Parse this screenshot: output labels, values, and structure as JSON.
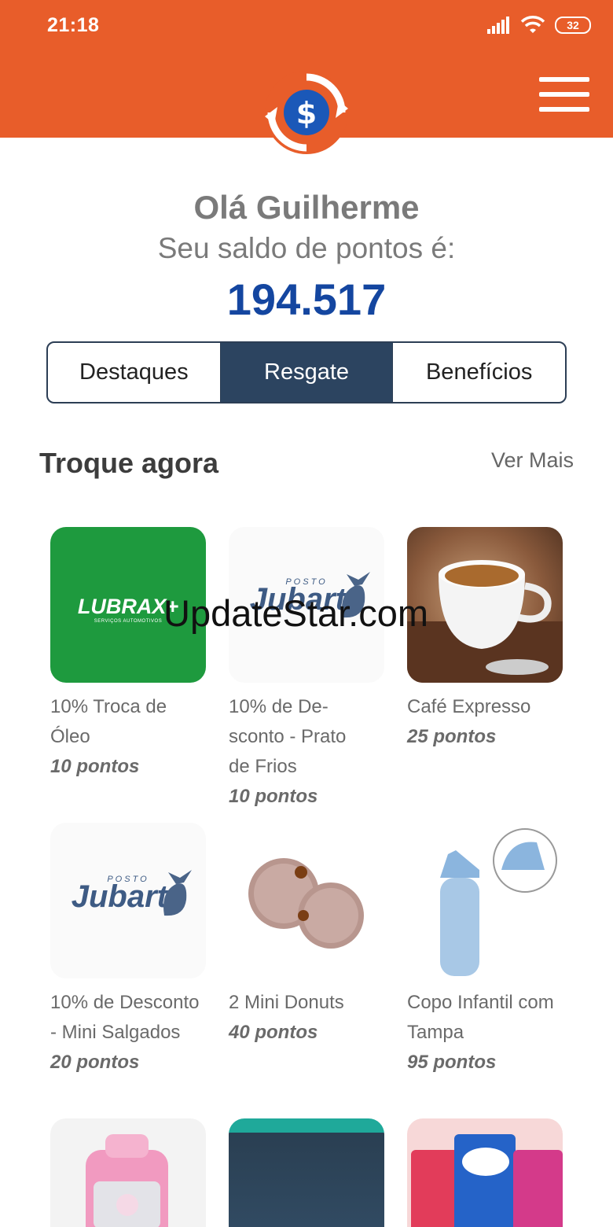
{
  "status": {
    "time": "21:18",
    "battery": "32"
  },
  "greeting": "Olá Guilherme",
  "subtitle": "Seu saldo de pontos é:",
  "points": "194.517",
  "tabs": [
    {
      "label": "Destaques",
      "active": false
    },
    {
      "label": "Resgate",
      "active": true
    },
    {
      "label": "Benefícios",
      "active": false
    }
  ],
  "section": {
    "title": "Troque agora",
    "see_more": "Ver Mais"
  },
  "items": [
    {
      "name": "10% Troca de Óleo",
      "points": "10 pontos",
      "brand": "LUBRAX+",
      "brand_sub": "SERVIÇOS AUTOMOTIVOS"
    },
    {
      "name": "10% de De-sconto - Prato de Frios",
      "points": "10 pontos",
      "brand": "Jubarte",
      "brand_sub": "POSTO"
    },
    {
      "name": "Café Expresso",
      "points": "25 pontos"
    },
    {
      "name": "10% de Desconto - Mini Salgados",
      "points": "20 pontos",
      "brand": "Jubarte",
      "brand_sub": "POSTO"
    },
    {
      "name": "2 Mini Donuts",
      "points": "40 pontos"
    },
    {
      "name": "Copo Infantil com Tampa",
      "points": "95 pontos"
    }
  ],
  "watermark": "UpdateStar.com",
  "colors": {
    "header": "#e85d2a",
    "points": "#1446a0",
    "tab_active": "#2c4460"
  }
}
